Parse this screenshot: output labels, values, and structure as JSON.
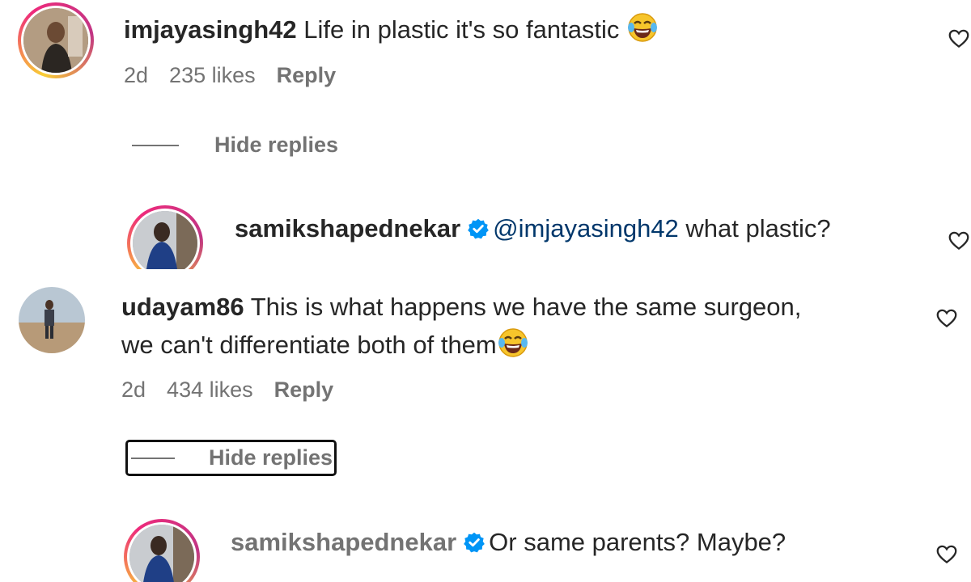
{
  "comments": [
    {
      "username": "imjayasingh42",
      "text": "Life in plastic it's so fantastic",
      "emoji": "face-with-tears-of-joy",
      "meta": {
        "age": "2d",
        "likes": "235 likes",
        "reply": "Reply"
      },
      "hide_replies": "Hide replies",
      "reply": {
        "username": "samikshapednekar",
        "verified": true,
        "mention": "@imjayasingh42",
        "text": "what plastic?"
      }
    },
    {
      "username": "udayam86",
      "text_line1": "This is what happens we have the same surgeon,",
      "text_line2": "we can't differentiate both of them",
      "emoji": "face-with-tears-of-joy",
      "meta": {
        "age": "2d",
        "likes": "434 likes",
        "reply": "Reply"
      },
      "hide_replies": "Hide replies",
      "reply": {
        "username": "samikshapednekar",
        "verified": true,
        "text": "Or same parents? Maybe?"
      }
    }
  ],
  "icons": {
    "like": "heart-outline-icon",
    "verified": "verified-badge-icon",
    "emoji": "face-with-tears-of-joy"
  },
  "colors": {
    "text": "#262626",
    "muted": "#737373",
    "mention": "#00376b",
    "verified": "#0095f6"
  }
}
